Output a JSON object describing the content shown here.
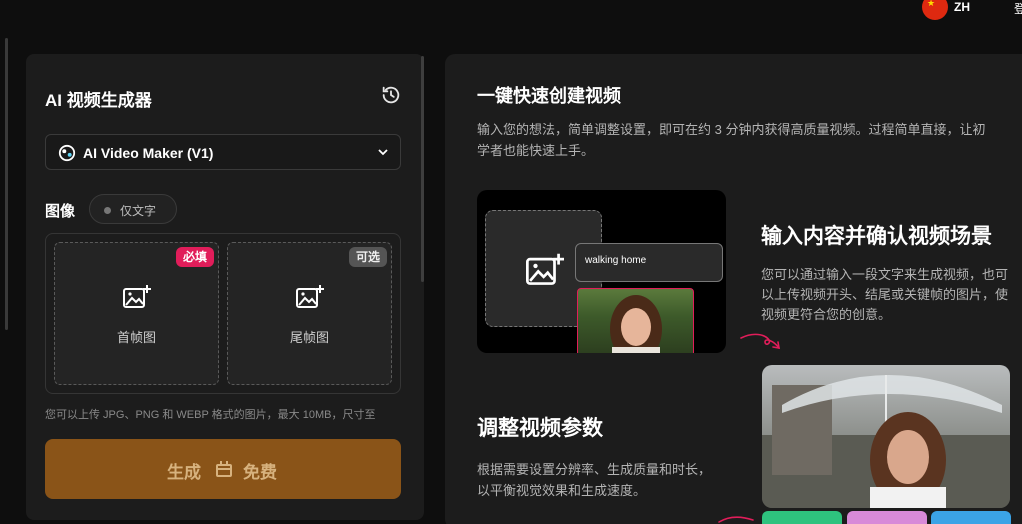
{
  "topbar": {
    "lang": "ZH",
    "login": "登"
  },
  "left": {
    "title": "AI 视频生成器",
    "model": "AI Video Maker (V1)",
    "image_label": "图像",
    "text_only": "仅文字",
    "first_frame": {
      "label": "首帧图",
      "badge": "必填"
    },
    "last_frame": {
      "label": "尾帧图",
      "badge": "可选"
    },
    "hint": "您可以上传 JPG、PNG 和 WEBP 格式的图片，最大 10MB，尺寸至",
    "generate": {
      "label": "生成",
      "free": "免费"
    }
  },
  "right": {
    "section1": {
      "title": "一键快速创建视频",
      "desc": "输入您的想法，简单调整设置，即可在约 3 分钟内获得高质量视频。过程简单直接，让初学者也能快速上手。"
    },
    "demo_input": "walking home",
    "section2": {
      "title": "输入内容并确认视频场景",
      "desc": "您可以通过输入一段文字来生成视频，也可以上传视频开头、结尾或关键帧的图片，使视频更符合您的创意。"
    },
    "section3": {
      "title": "调整视频参数",
      "desc": "根据需要设置分辨率、生成质量和时长，以平衡视觉效果和生成速度。"
    }
  },
  "colors": {
    "accent_orange": "#8a5418",
    "required_pink": "#e11d5a",
    "panel": "#1c1c1c",
    "bg": "#0e0e0e"
  },
  "icons": [
    "china-flag-icon",
    "history-icon",
    "model-logo-icon",
    "chevron-down-icon",
    "image-add-icon",
    "coin-icon",
    "arrow-doodle-icon"
  ]
}
